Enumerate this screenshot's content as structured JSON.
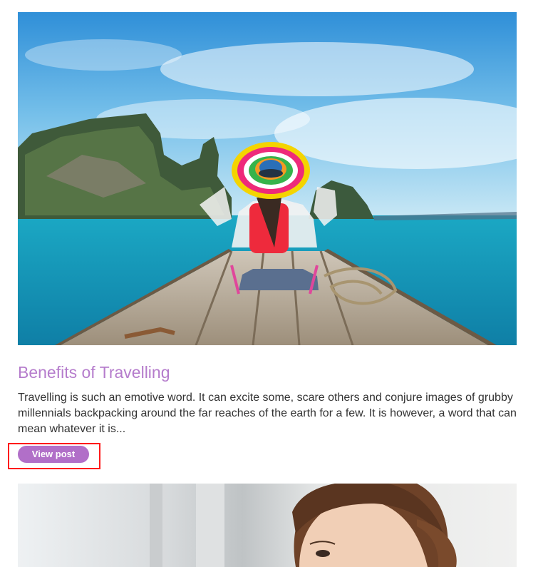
{
  "posts": [
    {
      "title": "Benefits of Travelling",
      "excerpt": "Travelling is such an emotive word. It can excite some, scare others and conjure images of grubby millennials backpacking around the far reaches of the earth for a few. It is however, a word that can mean whatever it is...",
      "button_label": "View post",
      "image_subject": "woman-on-boat-bow-photo"
    },
    {
      "image_subject": "woman-portrait-photo"
    }
  ],
  "colors": {
    "title": "#b57ccc",
    "button_bg": "#b16fc8",
    "button_text": "#ffffff",
    "body_text": "#333333",
    "highlight_border": "#ff1a1a"
  }
}
